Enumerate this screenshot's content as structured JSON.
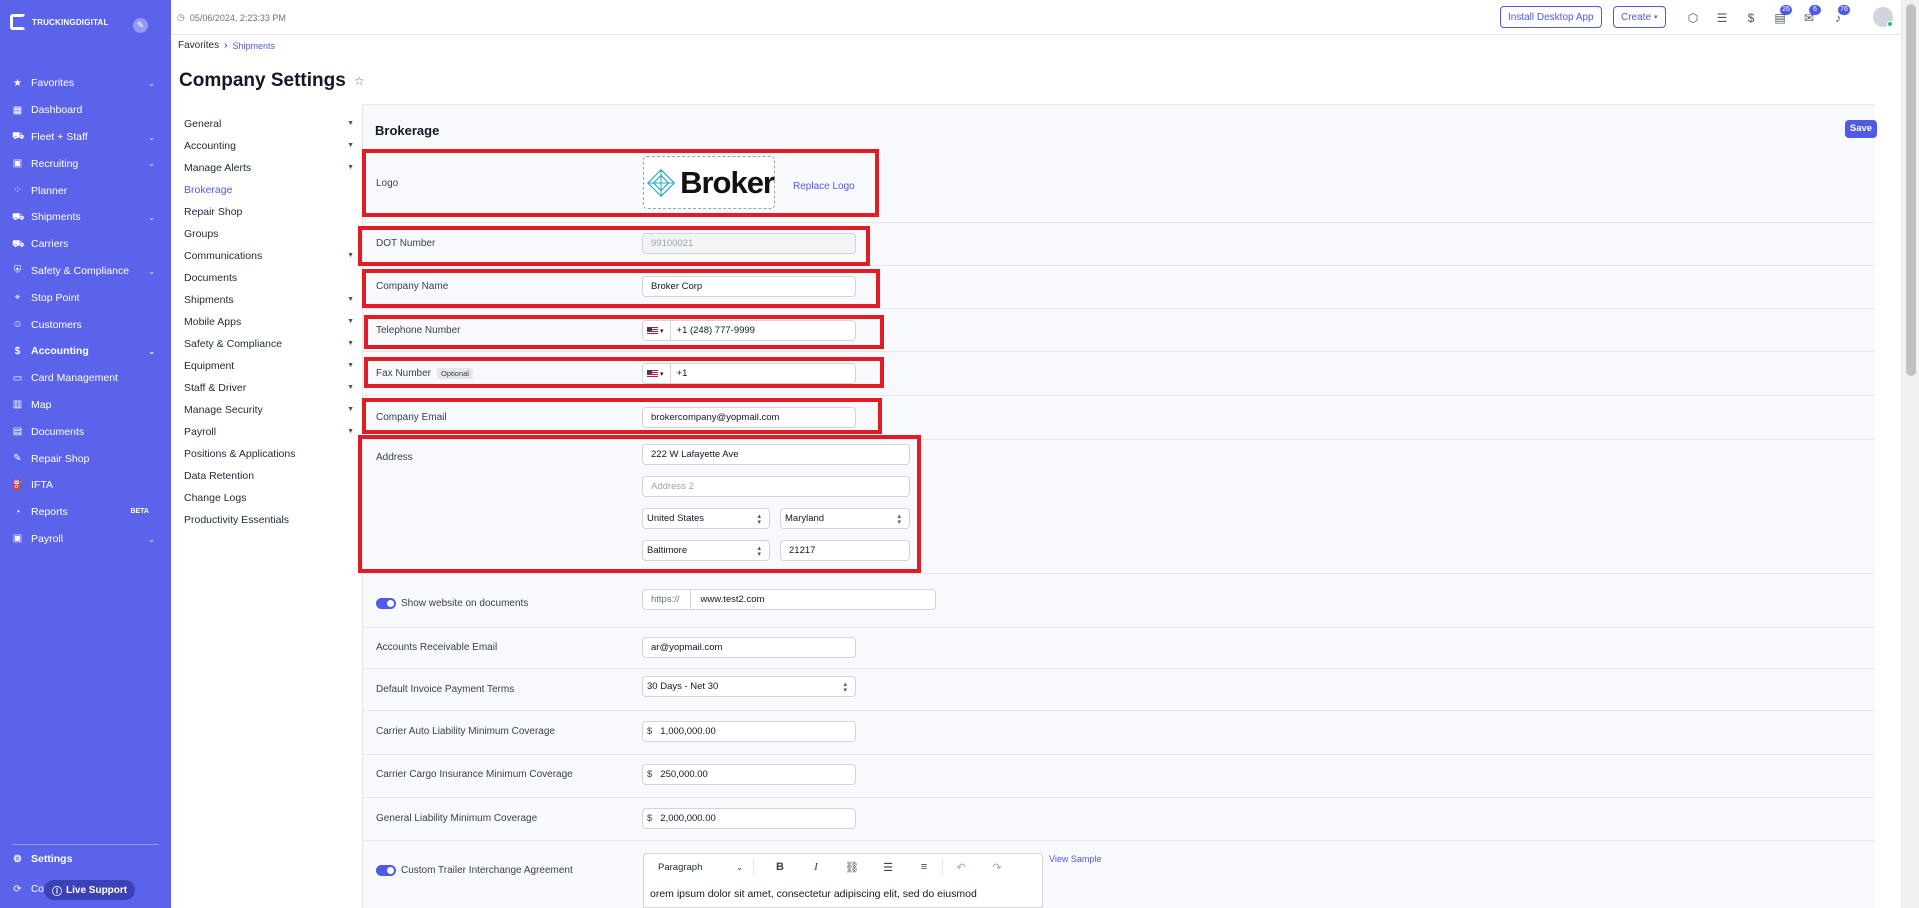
{
  "app": {
    "brand": "TRUCKINGDIGITAL"
  },
  "sidebar": {
    "items": [
      {
        "label": "Favorites",
        "icon": "star-icon",
        "chevron": true
      },
      {
        "label": "Dashboard",
        "icon": "grid-icon"
      },
      {
        "label": "Fleet + Staff",
        "icon": "truck-icon",
        "chevron": true
      },
      {
        "label": "Recruiting",
        "icon": "briefcase-icon",
        "chevron": true
      },
      {
        "label": "Planner",
        "icon": "planner-icon"
      },
      {
        "label": "Shipments",
        "icon": "shipment-icon",
        "chevron": true
      },
      {
        "label": "Carriers",
        "icon": "carrier-icon"
      },
      {
        "label": "Safety & Compliance",
        "icon": "shield-icon",
        "chevron": true
      },
      {
        "label": "Stop Point",
        "icon": "pin-icon"
      },
      {
        "label": "Customers",
        "icon": "users-icon"
      },
      {
        "label": "Accounting",
        "icon": "dollar-icon",
        "chevron": true,
        "bold": true
      },
      {
        "label": "Card Management",
        "icon": "card-icon"
      },
      {
        "label": "Map",
        "icon": "map-icon"
      },
      {
        "label": "Documents",
        "icon": "document-icon"
      },
      {
        "label": "Repair Shop",
        "icon": "wrench-icon"
      },
      {
        "label": "IFTA",
        "icon": "fuel-icon"
      },
      {
        "label": "Reports",
        "icon": "reports-icon",
        "badge": "BETA"
      },
      {
        "label": "Payroll",
        "icon": "payroll-icon",
        "chevron": true
      }
    ],
    "settings_label": "Settings",
    "co_label": "Co",
    "live_support_label": "Live Support"
  },
  "topbar": {
    "timestamp": "05/06/2024, 2:23:33 PM",
    "install_label": "Install Desktop App",
    "create_label": "Create",
    "badges": {
      "tasks": "26",
      "messages": "6",
      "notifications": "76"
    }
  },
  "breadcrumb": {
    "root": "Favorites",
    "current": "Shipments"
  },
  "page_title": "Company Settings",
  "subnav": {
    "items": [
      {
        "label": "General",
        "caret": true
      },
      {
        "label": "Accounting",
        "caret": true
      },
      {
        "label": "Manage Alerts",
        "caret": true
      },
      {
        "label": "Brokerage",
        "active": true
      },
      {
        "label": "Repair Shop"
      },
      {
        "label": "Groups"
      },
      {
        "label": "Communications",
        "caret": true
      },
      {
        "label": "Documents"
      },
      {
        "label": "Shipments",
        "caret": true
      },
      {
        "label": "Mobile Apps",
        "caret": true
      },
      {
        "label": "Safety & Compliance",
        "caret": true
      },
      {
        "label": "Equipment",
        "caret": true
      },
      {
        "label": "Staff & Driver",
        "caret": true
      },
      {
        "label": "Manage Security",
        "caret": true
      },
      {
        "label": "Payroll",
        "caret": true
      },
      {
        "label": "Positions & Applications"
      },
      {
        "label": "Data Retention"
      },
      {
        "label": "Change Logs"
      },
      {
        "label": "Productivity Essentials"
      }
    ]
  },
  "brokerage": {
    "title": "Brokerage",
    "save_label": "Save",
    "logo": {
      "label": "Logo",
      "logo_text": "Broker",
      "replace_label": "Replace Logo"
    },
    "dot": {
      "label": "DOT Number",
      "placeholder": "99100021"
    },
    "company_name": {
      "label": "Company Name",
      "value": "Broker Corp"
    },
    "telephone": {
      "label": "Telephone Number",
      "value": "+1 (248) 777-9999"
    },
    "fax": {
      "label": "Fax Number",
      "optional": "Optional",
      "value": "+1"
    },
    "email": {
      "label": "Company Email",
      "value": "brokercompany@yopmail.com"
    },
    "address": {
      "label": "Address",
      "line1": "222 W Lafayette Ave",
      "line2_placeholder": "Address 2",
      "country": "United States",
      "state": "Maryland",
      "city": "Baltimore",
      "zip": "21217"
    },
    "website": {
      "label": "Show website on documents",
      "prefix": "https://",
      "value": "www.test2.com",
      "enabled": true
    },
    "ar_email": {
      "label": "Accounts Receivable Email",
      "value": "ar@yopmail.com"
    },
    "payment_terms": {
      "label": "Default Invoice Payment Terms",
      "value": "30 Days - Net 30"
    },
    "auto_liability": {
      "label": "Carrier Auto Liability Minimum Coverage",
      "currency": "$",
      "value": "1,000,000.00"
    },
    "cargo_insurance": {
      "label": "Carrier Cargo Insurance Minimum Coverage",
      "currency": "$",
      "value": "250,000.00"
    },
    "general_liability": {
      "label": "General Liability Minimum Coverage",
      "currency": "$",
      "value": "2,000,000.00"
    },
    "trailer_agreement": {
      "label": "Custom Trailer Interchange Agreement",
      "enabled": true,
      "view_sample": "View Sample",
      "paragraph_label": "Paragraph",
      "body": "orem ipsum dolor sit amet, consectetur adipiscing elit, sed do eiusmod"
    }
  },
  "colors": {
    "accent": "#4f5ae6",
    "sidebar": "#5a63ea",
    "highlight": "#e01c24"
  }
}
